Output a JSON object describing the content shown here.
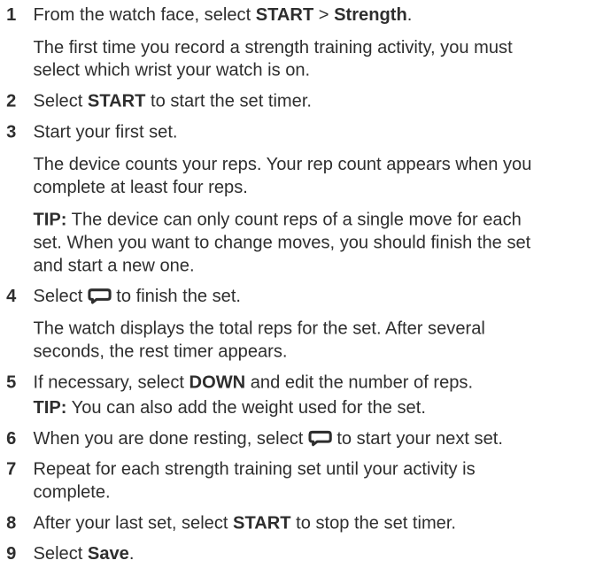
{
  "steps": [
    {
      "num": "1",
      "line_a": "From the watch face, select ",
      "k1": "START",
      "line_b": " > ",
      "k2": "Strength",
      "line_c": ".",
      "note": "The first time you record a strength training activity, you must select which wrist your watch is on."
    },
    {
      "num": "2",
      "line_a": "Select ",
      "k1": "START",
      "line_b": " to start the set timer."
    },
    {
      "num": "3",
      "text": "Start your first set.",
      "note": "The device counts your reps. Your rep count appears when you complete at least four reps.",
      "tip_label": "TIP:",
      "tip": " The device can only count reps of a single move for each set. When you want to change moves, you should finish the set and start a new one."
    },
    {
      "num": "4",
      "line_a": "Select ",
      "icon": "lap-loop-icon",
      "line_b": " to finish the set.",
      "note": "The watch displays the total reps for the set. After several seconds, the rest timer appears."
    },
    {
      "num": "5",
      "line_a": "If necessary, select ",
      "k1": "DOWN",
      "line_b": " and edit the number of reps.",
      "tip_label": "TIP:",
      "tip": " You can also add the weight used for the set."
    },
    {
      "num": "6",
      "line_a": "When you are done resting, select ",
      "icon": "lap-loop-icon",
      "line_b": " to start your next set."
    },
    {
      "num": "7",
      "text": "Repeat for each strength training set until your activity is complete."
    },
    {
      "num": "8",
      "line_a": "After your last set, select ",
      "k1": "START",
      "line_b": " to stop the set timer."
    },
    {
      "num": "9",
      "line_a": "Select ",
      "k1": "Save",
      "line_b": "."
    }
  ],
  "colors": {
    "text": "#2e2e2e"
  }
}
